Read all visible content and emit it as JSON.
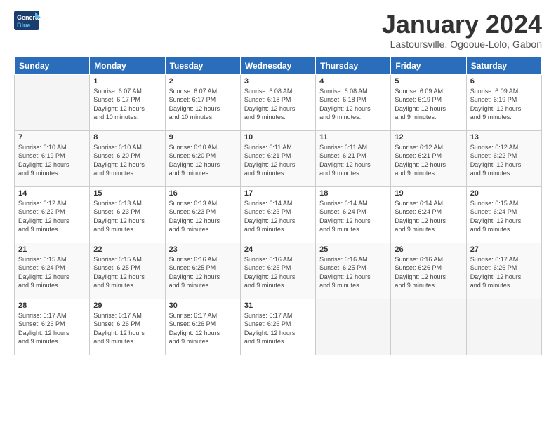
{
  "logo": {
    "line1": "General",
    "line2": "Blue"
  },
  "title": "January 2024",
  "subtitle": "Lastoursville, Ogooue-Lolo, Gabon",
  "days_of_week": [
    "Sunday",
    "Monday",
    "Tuesday",
    "Wednesday",
    "Thursday",
    "Friday",
    "Saturday"
  ],
  "weeks": [
    [
      {
        "day": "",
        "sunrise": "",
        "sunset": "",
        "daylight": ""
      },
      {
        "day": "1",
        "sunrise": "6:07 AM",
        "sunset": "6:17 PM",
        "daylight1": "12 hours",
        "daylight2": "and 10 minutes."
      },
      {
        "day": "2",
        "sunrise": "6:07 AM",
        "sunset": "6:17 PM",
        "daylight1": "12 hours",
        "daylight2": "and 10 minutes."
      },
      {
        "day": "3",
        "sunrise": "6:08 AM",
        "sunset": "6:18 PM",
        "daylight1": "12 hours",
        "daylight2": "and 9 minutes."
      },
      {
        "day": "4",
        "sunrise": "6:08 AM",
        "sunset": "6:18 PM",
        "daylight1": "12 hours",
        "daylight2": "and 9 minutes."
      },
      {
        "day": "5",
        "sunrise": "6:09 AM",
        "sunset": "6:19 PM",
        "daylight1": "12 hours",
        "daylight2": "and 9 minutes."
      },
      {
        "day": "6",
        "sunrise": "6:09 AM",
        "sunset": "6:19 PM",
        "daylight1": "12 hours",
        "daylight2": "and 9 minutes."
      }
    ],
    [
      {
        "day": "7",
        "sunrise": "6:10 AM",
        "sunset": "6:19 PM",
        "daylight1": "12 hours",
        "daylight2": "and 9 minutes."
      },
      {
        "day": "8",
        "sunrise": "6:10 AM",
        "sunset": "6:20 PM",
        "daylight1": "12 hours",
        "daylight2": "and 9 minutes."
      },
      {
        "day": "9",
        "sunrise": "6:10 AM",
        "sunset": "6:20 PM",
        "daylight1": "12 hours",
        "daylight2": "and 9 minutes."
      },
      {
        "day": "10",
        "sunrise": "6:11 AM",
        "sunset": "6:21 PM",
        "daylight1": "12 hours",
        "daylight2": "and 9 minutes."
      },
      {
        "day": "11",
        "sunrise": "6:11 AM",
        "sunset": "6:21 PM",
        "daylight1": "12 hours",
        "daylight2": "and 9 minutes."
      },
      {
        "day": "12",
        "sunrise": "6:12 AM",
        "sunset": "6:21 PM",
        "daylight1": "12 hours",
        "daylight2": "and 9 minutes."
      },
      {
        "day": "13",
        "sunrise": "6:12 AM",
        "sunset": "6:22 PM",
        "daylight1": "12 hours",
        "daylight2": "and 9 minutes."
      }
    ],
    [
      {
        "day": "14",
        "sunrise": "6:12 AM",
        "sunset": "6:22 PM",
        "daylight1": "12 hours",
        "daylight2": "and 9 minutes."
      },
      {
        "day": "15",
        "sunrise": "6:13 AM",
        "sunset": "6:23 PM",
        "daylight1": "12 hours",
        "daylight2": "and 9 minutes."
      },
      {
        "day": "16",
        "sunrise": "6:13 AM",
        "sunset": "6:23 PM",
        "daylight1": "12 hours",
        "daylight2": "and 9 minutes."
      },
      {
        "day": "17",
        "sunrise": "6:14 AM",
        "sunset": "6:23 PM",
        "daylight1": "12 hours",
        "daylight2": "and 9 minutes."
      },
      {
        "day": "18",
        "sunrise": "6:14 AM",
        "sunset": "6:24 PM",
        "daylight1": "12 hours",
        "daylight2": "and 9 minutes."
      },
      {
        "day": "19",
        "sunrise": "6:14 AM",
        "sunset": "6:24 PM",
        "daylight1": "12 hours",
        "daylight2": "and 9 minutes."
      },
      {
        "day": "20",
        "sunrise": "6:15 AM",
        "sunset": "6:24 PM",
        "daylight1": "12 hours",
        "daylight2": "and 9 minutes."
      }
    ],
    [
      {
        "day": "21",
        "sunrise": "6:15 AM",
        "sunset": "6:24 PM",
        "daylight1": "12 hours",
        "daylight2": "and 9 minutes."
      },
      {
        "day": "22",
        "sunrise": "6:15 AM",
        "sunset": "6:25 PM",
        "daylight1": "12 hours",
        "daylight2": "and 9 minutes."
      },
      {
        "day": "23",
        "sunrise": "6:16 AM",
        "sunset": "6:25 PM",
        "daylight1": "12 hours",
        "daylight2": "and 9 minutes."
      },
      {
        "day": "24",
        "sunrise": "6:16 AM",
        "sunset": "6:25 PM",
        "daylight1": "12 hours",
        "daylight2": "and 9 minutes."
      },
      {
        "day": "25",
        "sunrise": "6:16 AM",
        "sunset": "6:25 PM",
        "daylight1": "12 hours",
        "daylight2": "and 9 minutes."
      },
      {
        "day": "26",
        "sunrise": "6:16 AM",
        "sunset": "6:26 PM",
        "daylight1": "12 hours",
        "daylight2": "and 9 minutes."
      },
      {
        "day": "27",
        "sunrise": "6:17 AM",
        "sunset": "6:26 PM",
        "daylight1": "12 hours",
        "daylight2": "and 9 minutes."
      }
    ],
    [
      {
        "day": "28",
        "sunrise": "6:17 AM",
        "sunset": "6:26 PM",
        "daylight1": "12 hours",
        "daylight2": "and 9 minutes."
      },
      {
        "day": "29",
        "sunrise": "6:17 AM",
        "sunset": "6:26 PM",
        "daylight1": "12 hours",
        "daylight2": "and 9 minutes."
      },
      {
        "day": "30",
        "sunrise": "6:17 AM",
        "sunset": "6:26 PM",
        "daylight1": "12 hours",
        "daylight2": "and 9 minutes."
      },
      {
        "day": "31",
        "sunrise": "6:17 AM",
        "sunset": "6:26 PM",
        "daylight1": "12 hours",
        "daylight2": "and 9 minutes."
      },
      {
        "day": "",
        "sunrise": "",
        "sunset": "",
        "daylight1": "",
        "daylight2": ""
      },
      {
        "day": "",
        "sunrise": "",
        "sunset": "",
        "daylight1": "",
        "daylight2": ""
      },
      {
        "day": "",
        "sunrise": "",
        "sunset": "",
        "daylight1": "",
        "daylight2": ""
      }
    ]
  ],
  "labels": {
    "sunrise": "Sunrise:",
    "sunset": "Sunset:",
    "daylight": "Daylight: 12 hours"
  }
}
